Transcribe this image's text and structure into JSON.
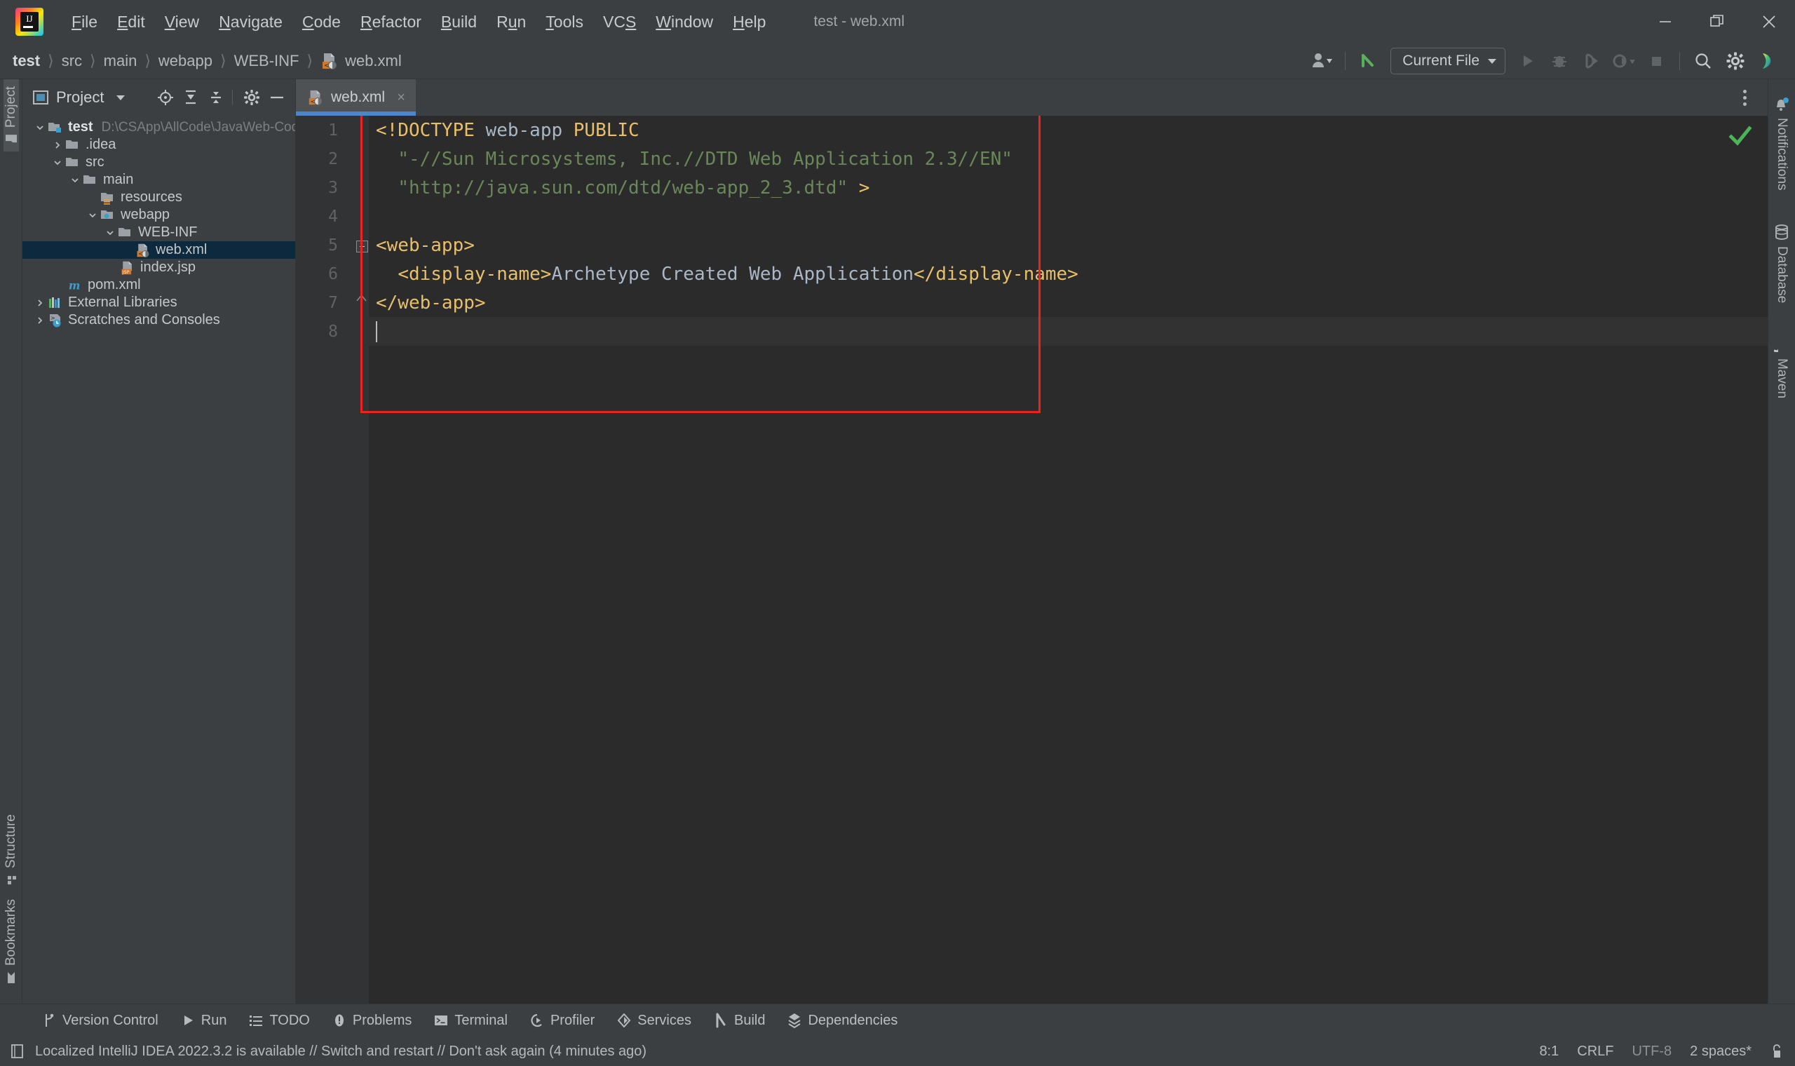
{
  "window": {
    "title": "test - web.xml",
    "controls": [
      "minimize-icon",
      "restore-icon",
      "close-icon"
    ]
  },
  "menubar": {
    "items": [
      {
        "label": "File",
        "mnemonic": "F"
      },
      {
        "label": "Edit",
        "mnemonic": "E"
      },
      {
        "label": "View",
        "mnemonic": "V"
      },
      {
        "label": "Navigate",
        "mnemonic": "N"
      },
      {
        "label": "Code",
        "mnemonic": "C"
      },
      {
        "label": "Refactor",
        "mnemonic": "R"
      },
      {
        "label": "Build",
        "mnemonic": "B"
      },
      {
        "label": "Run",
        "mnemonic": "u"
      },
      {
        "label": "Tools",
        "mnemonic": "T"
      },
      {
        "label": "VCS",
        "mnemonic": "S"
      },
      {
        "label": "Window",
        "mnemonic": "W"
      },
      {
        "label": "Help",
        "mnemonic": "H"
      }
    ]
  },
  "navbar": {
    "breadcrumb": [
      "test",
      "src",
      "main",
      "webapp",
      "WEB-INF",
      "web.xml"
    ],
    "separator": "〉",
    "run_config": "Current File",
    "icons": [
      "account-icon",
      "vcs-update-icon",
      "run-icon",
      "debug-icon",
      "run-with-coverage-icon",
      "profile-icon",
      "stop-icon",
      "search-everywhere-icon",
      "settings-gear-icon",
      "ide-assistant-icon"
    ]
  },
  "left_rail": {
    "top": [
      {
        "label": "Project",
        "icon": "project-folder-icon",
        "active": true
      }
    ],
    "bottom": [
      {
        "label": "Structure",
        "icon": "structure-icon"
      },
      {
        "label": "Bookmarks",
        "icon": "bookmark-icon"
      }
    ]
  },
  "right_rail": {
    "items": [
      {
        "label": "Notifications",
        "icon": "bell-icon",
        "badge": true
      },
      {
        "label": "Database",
        "icon": "database-icon"
      },
      {
        "label": "Maven",
        "icon": "maven-m-icon"
      }
    ]
  },
  "project_panel": {
    "title": "Project",
    "toolbar_icons": [
      "select-opened-file-icon",
      "expand-all-icon",
      "collapse-all-icon",
      "settings-gear-icon",
      "hide-icon"
    ],
    "tree": [
      {
        "depth": 0,
        "twist": "down",
        "icon": "module-folder-icon",
        "label": "test",
        "bold": true,
        "path": "D:\\CSApp\\AllCode\\JavaWeb-Code\\test",
        "selected": false
      },
      {
        "depth": 1,
        "twist": "right",
        "icon": "folder-icon",
        "label": ".idea",
        "bold": false,
        "path": "",
        "selected": false
      },
      {
        "depth": 1,
        "twist": "down",
        "icon": "folder-icon",
        "label": "src",
        "bold": false,
        "path": "",
        "selected": false
      },
      {
        "depth": 2,
        "twist": "down",
        "icon": "folder-icon",
        "label": "main",
        "bold": false,
        "path": "",
        "selected": false
      },
      {
        "depth": 3,
        "twist": "none",
        "icon": "resources-folder-icon",
        "label": "resources",
        "bold": false,
        "path": "",
        "selected": false
      },
      {
        "depth": 3,
        "twist": "down",
        "icon": "webapp-folder-icon",
        "label": "webapp",
        "bold": false,
        "path": "",
        "selected": false
      },
      {
        "depth": 4,
        "twist": "down",
        "icon": "folder-icon",
        "label": "WEB-INF",
        "bold": false,
        "path": "",
        "selected": false
      },
      {
        "depth": 5,
        "twist": "none",
        "icon": "xml-file-icon",
        "label": "web.xml",
        "bold": false,
        "path": "",
        "selected": true
      },
      {
        "depth": 4,
        "twist": "none",
        "icon": "jsp-file-icon",
        "label": "index.jsp",
        "bold": false,
        "path": "",
        "selected": false
      },
      {
        "depth": 2,
        "twist": "none",
        "icon": "maven-pom-icon",
        "label": "pom.xml",
        "bold": false,
        "path": "",
        "selected": false
      },
      {
        "depth": 0,
        "twist": "right",
        "icon": "external-libraries-icon",
        "label": "External Libraries",
        "bold": false,
        "path": "",
        "selected": false
      },
      {
        "depth": 0,
        "twist": "right",
        "icon": "scratches-icon",
        "label": "Scratches and Consoles",
        "bold": false,
        "path": "",
        "selected": false
      }
    ]
  },
  "editor": {
    "tab": {
      "label": "web.xml",
      "icon": "xml-file-icon",
      "close": "×"
    },
    "inspection_status": "ok-check-icon",
    "line_numbers": [
      "1",
      "2",
      "3",
      "4",
      "5",
      "6",
      "7",
      "8"
    ],
    "lines": [
      {
        "n": "1",
        "segs": [
          {
            "t": "tag",
            "s": "<!DOCTYPE "
          },
          {
            "t": "txt",
            "s": "web-app "
          },
          {
            "t": "tag",
            "s": "PUBLIC"
          }
        ]
      },
      {
        "n": "2",
        "segs": [
          {
            "t": "plain",
            "s": "  "
          },
          {
            "t": "str",
            "s": "\"-//Sun Microsystems, Inc.//DTD Web Application 2.3//EN\""
          }
        ]
      },
      {
        "n": "3",
        "segs": [
          {
            "t": "plain",
            "s": "  "
          },
          {
            "t": "str",
            "s": "\"http://java.sun.com/dtd/web-app_2_3.dtd\" "
          },
          {
            "t": "tag",
            "s": ">"
          }
        ]
      },
      {
        "n": "4",
        "segs": []
      },
      {
        "n": "5",
        "segs": [
          {
            "t": "tag",
            "s": "<web-app>"
          }
        ]
      },
      {
        "n": "6",
        "segs": [
          {
            "t": "plain",
            "s": "  "
          },
          {
            "t": "tag",
            "s": "<display-name>"
          },
          {
            "t": "txt",
            "s": "Archetype Created Web Application"
          },
          {
            "t": "tag",
            "s": "</display-name>"
          }
        ]
      },
      {
        "n": "7",
        "segs": [
          {
            "t": "tag",
            "s": "</web-app>"
          }
        ]
      },
      {
        "n": "8",
        "segs": [],
        "caret": true
      }
    ]
  },
  "toolwindows": [
    {
      "label": "Version Control",
      "icon": "branch-icon"
    },
    {
      "label": "Run",
      "icon": "run-triangle-icon"
    },
    {
      "label": "TODO",
      "icon": "todo-list-icon"
    },
    {
      "label": "Problems",
      "icon": "problems-icon"
    },
    {
      "label": "Terminal",
      "icon": "terminal-icon"
    },
    {
      "label": "Profiler",
      "icon": "profiler-icon"
    },
    {
      "label": "Services",
      "icon": "services-icon"
    },
    {
      "label": "Build",
      "icon": "build-hammer-icon"
    },
    {
      "label": "Dependencies",
      "icon": "dependencies-icon"
    }
  ],
  "statusbar": {
    "message": "Localized IntelliJ IDEA 2022.3.2 is available // Switch and restart // Don't ask again (4 minutes ago)",
    "message_icon": "ide-notice-icon",
    "caret_position": "8:1",
    "line_separator": "CRLF",
    "encoding": "UTF-8",
    "indent": "2 spaces*",
    "lock_icon": "unlocked-icon"
  },
  "colors": {
    "bg": "#3c3f41",
    "editor_bg": "#2b2b2b",
    "gutter_bg": "#313335",
    "selection": "#0d293e",
    "tab_underline": "#4a88c7",
    "tag": "#e8bf6a",
    "string": "#6a8759",
    "text": "#a9b7c6",
    "highlight_box": "#ee2222",
    "ok_check": "#49b557"
  }
}
